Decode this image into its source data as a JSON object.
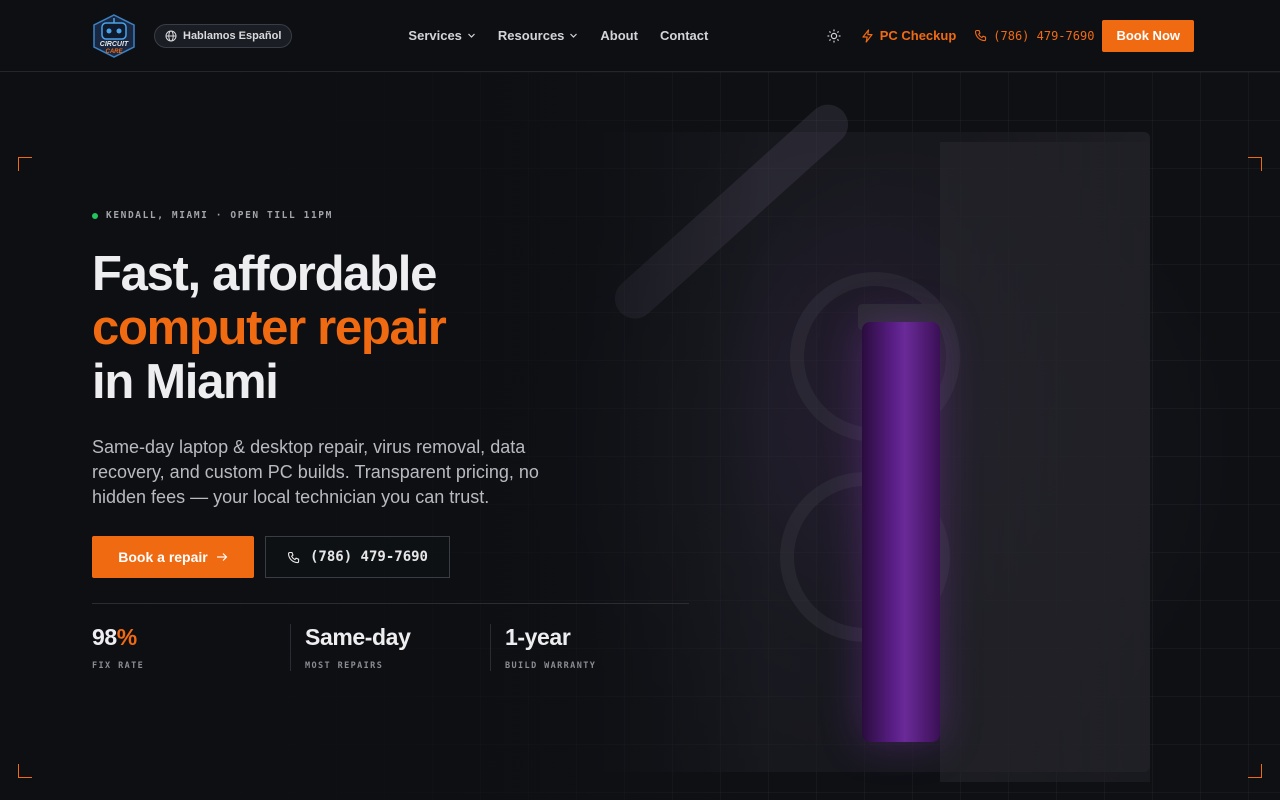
{
  "brand": {
    "logo_text_1": "CIRCUIT",
    "logo_text_2": "CARE"
  },
  "header": {
    "language_label": "Hablamos Español",
    "nav": [
      {
        "label": "Services",
        "has_dropdown": true
      },
      {
        "label": "Resources",
        "has_dropdown": true
      },
      {
        "label": "About",
        "has_dropdown": false
      },
      {
        "label": "Contact",
        "has_dropdown": false
      }
    ],
    "checkup_label": "PC Checkup",
    "phone": "(786) 479-7690",
    "book_label": "Book Now"
  },
  "hero": {
    "status": "KENDALL, MIAMI · OPEN TILL 11PM",
    "title_line1": "Fast, affordable",
    "title_line2": "computer repair",
    "title_line3": "in Miami",
    "description": "Same-day laptop & desktop repair, virus removal, data recovery, and custom PC builds. Transparent pricing, no hidden fees — your local technician you can trust.",
    "primary_cta": "Book a repair",
    "secondary_cta": "(786) 479-7690",
    "stats": [
      {
        "value": "98",
        "suffix": "%",
        "label": "FIX RATE"
      },
      {
        "value": "Same-day",
        "label": "MOST REPAIRS"
      },
      {
        "value": "1-year",
        "label": "BUILD WARRANTY"
      }
    ]
  },
  "colors": {
    "accent": "#f06a12",
    "status_dot": "#22c55e",
    "background": "#0d0f13"
  }
}
